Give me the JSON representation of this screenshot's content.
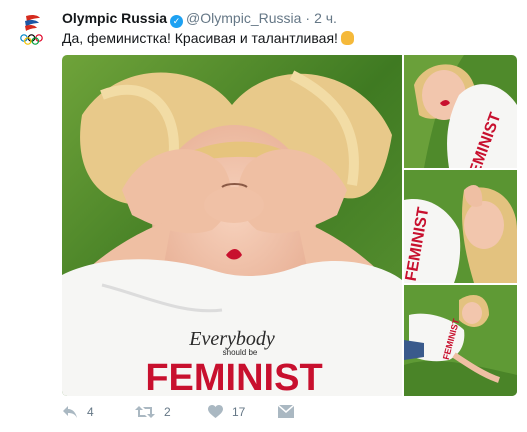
{
  "tweet": {
    "author_name": "Olympic Russia",
    "handle": "@Olympic_Russia",
    "separator": "·",
    "time": "2 ч.",
    "text": "Да, феминистка! Красивая и талантливая!",
    "emoji_icon": "person-emoji"
  },
  "media": {
    "main_photo": {
      "shirt_text_top": "Everybody",
      "shirt_text_middle": "should be",
      "shirt_text_bottom": "FEMINIST"
    },
    "side_photos": [
      {
        "shirt_text": "FEMINIST"
      },
      {
        "shirt_text": "FEMINIST"
      },
      {
        "shirt_text": "FEMINIST"
      }
    ]
  },
  "actions": {
    "reply_count": "4",
    "retweet_count": "2",
    "like_count": "17"
  },
  "colors": {
    "accent": "#1da1f2",
    "icon_gray": "#aab8c2",
    "shirt_red": "#c8102e",
    "grass": "#4f8a2b"
  }
}
